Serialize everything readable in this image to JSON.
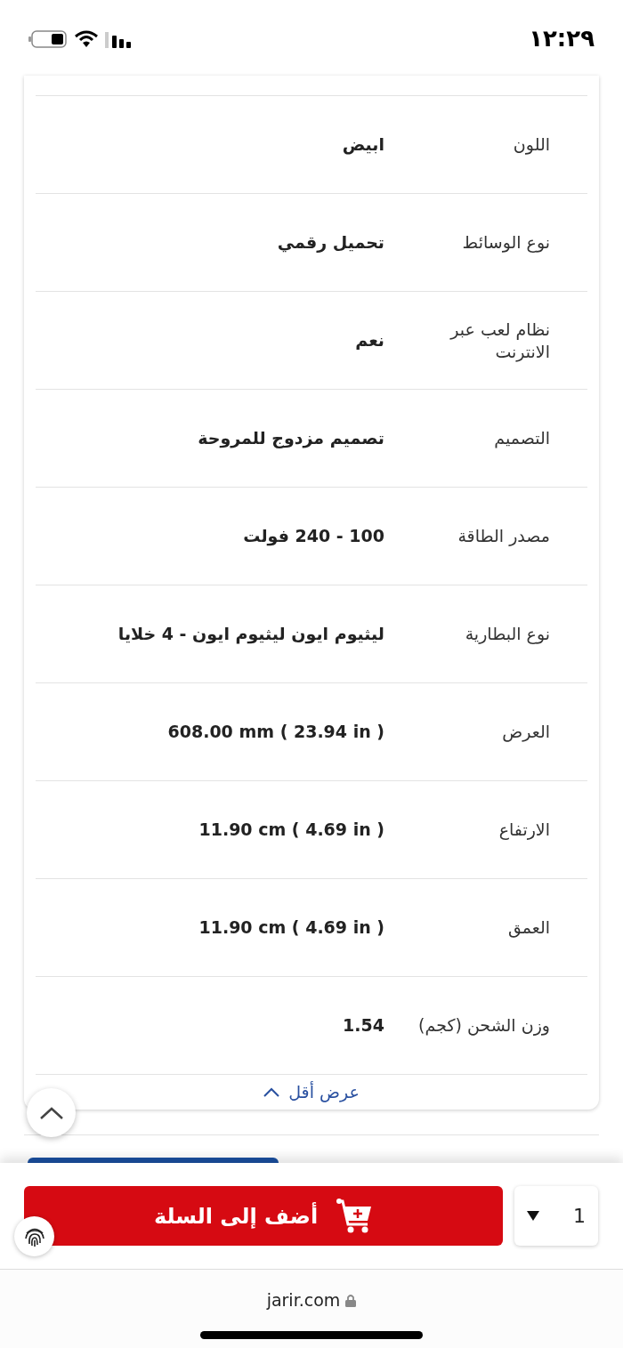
{
  "status_bar": {
    "time": "١٢:٢٩"
  },
  "specs": [
    {
      "label": "اللون",
      "value": "ابيض"
    },
    {
      "label": "نوع الوسائط",
      "value": "تحميل رقمي"
    },
    {
      "label": "نظام لعب عبر الانترنت",
      "value": "نعم"
    },
    {
      "label": "التصميم",
      "value": "تصميم مزدوج للمروحة"
    },
    {
      "label": "مصدر الطاقة",
      "value": "100 - 240 فولت"
    },
    {
      "label": "نوع البطارية",
      "value": "ليثيوم ايون ليثيوم ايون - 4 خلايا"
    },
    {
      "label": "العرض",
      "value": "608.00 mm ( 23.94 in )"
    },
    {
      "label": "الارتفاع",
      "value": "11.90 cm ( 4.69 in )"
    },
    {
      "label": "العمق",
      "value": "11.90 cm ( 4.69 in )"
    },
    {
      "label": "وزن الشحن (كجم)",
      "value": "1.54"
    }
  ],
  "show_less": {
    "label": "عرض أقل"
  },
  "cart_bar": {
    "add_to_cart": "أضف إلى السلة",
    "quantity": "1"
  },
  "browser": {
    "address": "jarir.com"
  }
}
